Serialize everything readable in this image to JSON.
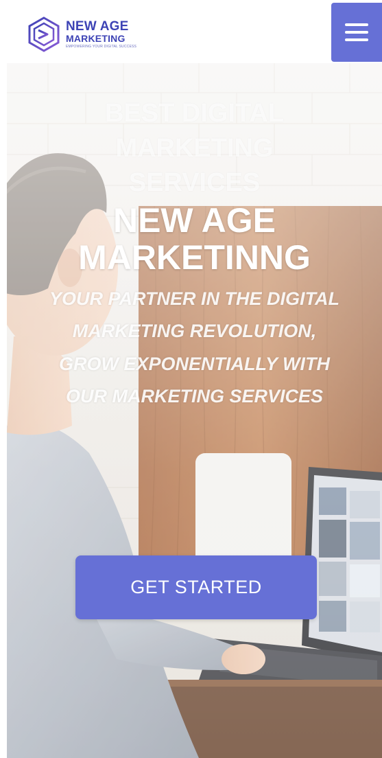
{
  "brand": {
    "name_line1": "NEW AGE",
    "name_line2": "MARKETING",
    "tagline": "EMPOWERING YOUR DIGITAL SUCCESS"
  },
  "nav": {
    "menu_icon": "hamburger-menu-icon"
  },
  "hero": {
    "eyebrow": "BEST DIGITAL MARKETING SERVICES",
    "title": "NEW AGE MARKETINNG",
    "subtitle": "YOUR PARTNER IN THE DIGITAL MARKETING REVOLUTION, GROW EXPONENTIALLY WITH OUR MARKETING SERVICES",
    "cta_label": "GET STARTED"
  },
  "colors": {
    "accent": "#6670d6",
    "brand": "#3d43b5",
    "hero_text": "#ffffff"
  }
}
